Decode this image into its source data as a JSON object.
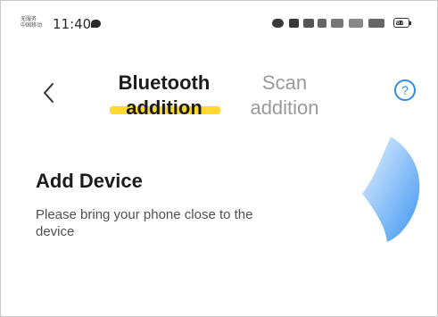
{
  "status_bar": {
    "carrier_line1": "无服务",
    "carrier_line2": "中国移动",
    "time": "11:40",
    "battery_percent": 67,
    "battery_label": "67"
  },
  "header": {
    "tabs": [
      {
        "line1": "Bluetooth",
        "line2": "addition",
        "active": true
      },
      {
        "line1": "Scan",
        "line2": "addition",
        "active": false
      }
    ],
    "help_glyph": "?",
    "back_icon": "chevron-left-icon",
    "help_icon": "help-circle-icon"
  },
  "content": {
    "title": "Add Device",
    "hint": "Please bring your phone close to the device"
  },
  "colors": {
    "accent_underline": "#ffd92e",
    "help_blue": "#2f8be6",
    "inactive_tab": "#9a9a9a",
    "illustration_start": "#d9ecff",
    "illustration_end": "#4a9ef5"
  }
}
